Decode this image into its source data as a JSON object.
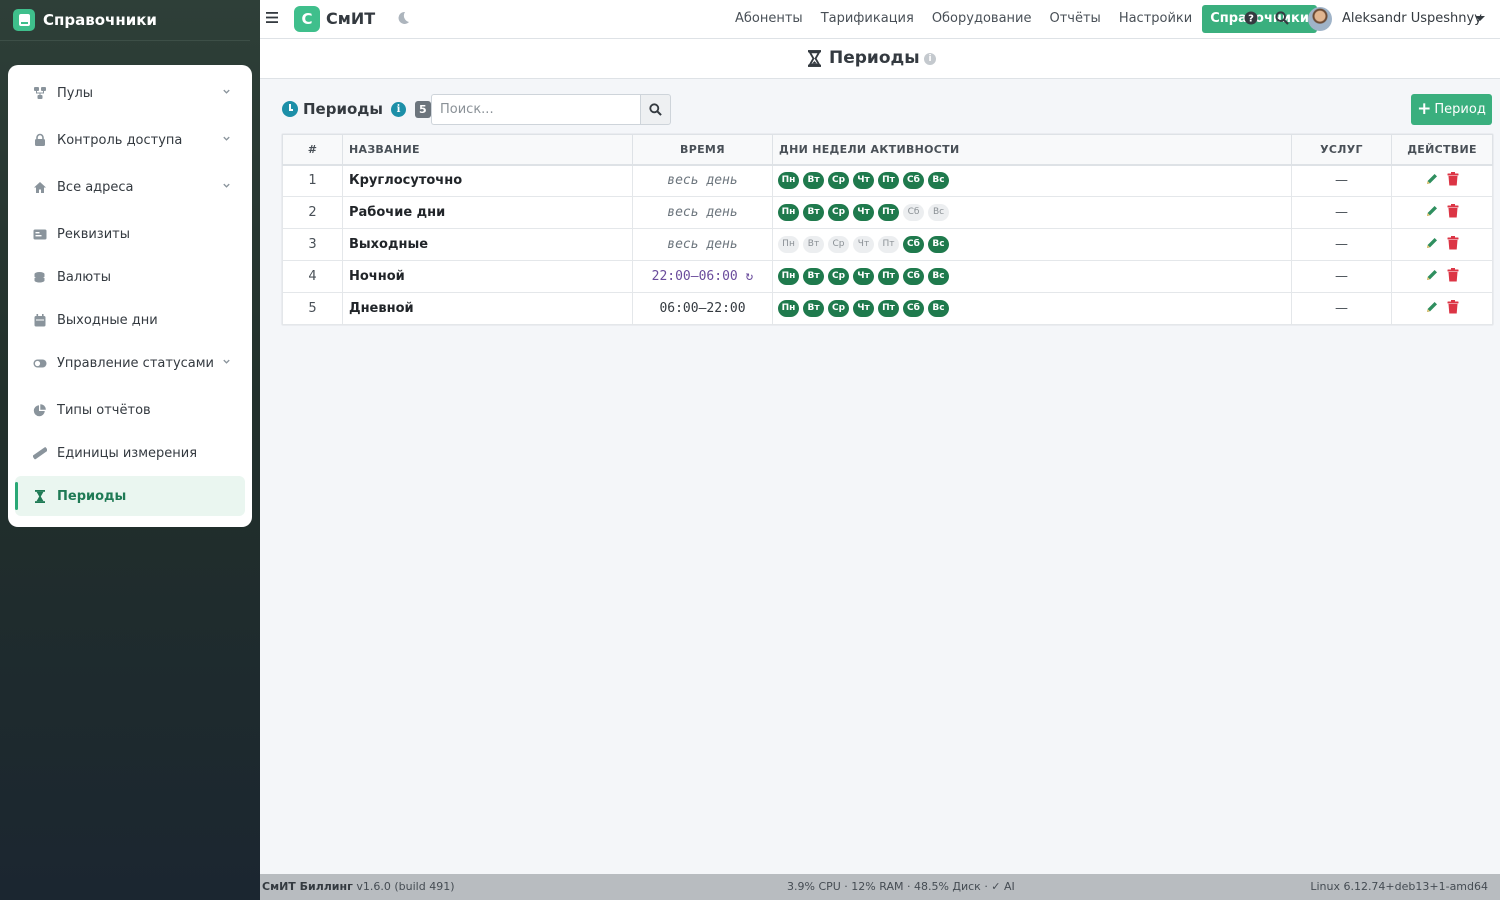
{
  "sidebar": {
    "brand": "Справочники",
    "items": [
      {
        "label": "Пулы",
        "icon": "network-icon",
        "chevron": true
      },
      {
        "label": "Контроль доступа",
        "icon": "lock-icon",
        "chevron": true
      },
      {
        "label": "Все адреса",
        "icon": "home-icon",
        "chevron": true
      },
      {
        "label": "Реквизиты",
        "icon": "id-card-icon",
        "chevron": false
      },
      {
        "label": "Валюты",
        "icon": "coins-icon",
        "chevron": false
      },
      {
        "label": "Выходные дни",
        "icon": "calendar-icon",
        "chevron": false
      },
      {
        "label": "Управление статусами",
        "icon": "toggle-icon",
        "chevron": true
      },
      {
        "label": "Типы отчётов",
        "icon": "pie-chart-icon",
        "chevron": false
      },
      {
        "label": "Единицы измерения",
        "icon": "ruler-icon",
        "chevron": false
      },
      {
        "label": "Периоды",
        "icon": "hourglass-icon",
        "chevron": false,
        "active": true
      }
    ]
  },
  "topbar": {
    "logo_letter": "С",
    "logo_text": "СмИТ",
    "nav": [
      "Абоненты",
      "Тарификация",
      "Оборудование",
      "Отчёты",
      "Настройки"
    ],
    "nav_active": "Справочники",
    "user": "Aleksandr Uspeshnyy"
  },
  "page": {
    "title": "Периоды",
    "info_glyph": "i"
  },
  "toolbar": {
    "title": "Периоды",
    "info_glyph": "i",
    "count": "5",
    "search_placeholder": "Поиск...",
    "add_label": "Период",
    "add_glyph": "+"
  },
  "table": {
    "headers": {
      "num": "#",
      "name": "Название",
      "time": "Время",
      "days": "Дни недели активности",
      "services": "Услуг",
      "action": "Действие"
    },
    "day_labels": [
      "Пн",
      "Вт",
      "Ср",
      "Чт",
      "Пт",
      "Сб",
      "Вс"
    ],
    "rows": [
      {
        "num": "1",
        "name": "Круглосуточно",
        "time": "весь день",
        "time_style": "italic",
        "days": [
          1,
          1,
          1,
          1,
          1,
          1,
          1
        ],
        "services": "—"
      },
      {
        "num": "2",
        "name": "Рабочие дни",
        "time": "весь день",
        "time_style": "italic",
        "days": [
          1,
          1,
          1,
          1,
          1,
          0,
          0
        ],
        "services": "—"
      },
      {
        "num": "3",
        "name": "Выходные",
        "time": "весь день",
        "time_style": "italic",
        "days": [
          0,
          0,
          0,
          0,
          0,
          1,
          1
        ],
        "services": "—"
      },
      {
        "num": "4",
        "name": "Ночной",
        "time": "22:00–06:00 ↻",
        "time_style": "night",
        "days": [
          1,
          1,
          1,
          1,
          1,
          1,
          1
        ],
        "services": "—"
      },
      {
        "num": "5",
        "name": "Дневной",
        "time": "06:00–22:00",
        "time_style": "normal",
        "days": [
          1,
          1,
          1,
          1,
          1,
          1,
          1
        ],
        "services": "—"
      }
    ]
  },
  "footer": {
    "app_name": "СмИТ Биллинг",
    "version": "v1.6.0 (build 491)",
    "stats": "3.9% CPU · 12% RAM · 48.5% Диск · ✓ AI",
    "system": "Linux 6.12.74+deb13+1-amd64"
  },
  "colors": {
    "accent": "#3aaf7e",
    "day_on": "#1f7a4d",
    "delete": "#dc3545",
    "edit": "#2f8f5f",
    "info": "#1c8fa8"
  }
}
